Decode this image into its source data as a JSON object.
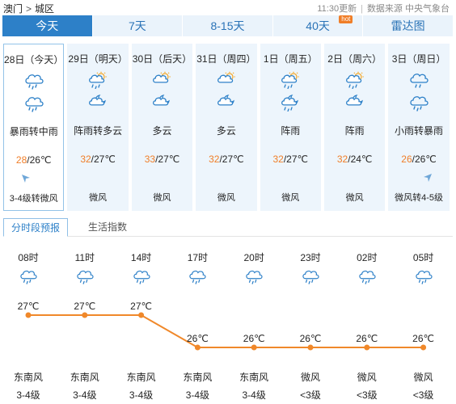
{
  "header": {
    "breadcrumb": [
      "澳门",
      "城区"
    ],
    "breadcrumb_sep": ">",
    "update_time": "11:30更新",
    "source": "数据来源 中央气象台"
  },
  "tabs": [
    {
      "label": "今天",
      "active": true
    },
    {
      "label": "7天",
      "active": false
    },
    {
      "label": "8-15天",
      "active": false
    },
    {
      "label": "40天",
      "active": false,
      "badge": "hot"
    },
    {
      "label": "雷达图",
      "active": false
    }
  ],
  "days": [
    {
      "date": "28日（今天）",
      "icon_day": "rain-heavy-icon",
      "icon_night": "rain-heavy-icon",
      "desc": "暴雨转中雨",
      "hi": "28",
      "lo": "/26℃",
      "wind": "3-4级转微风",
      "arrow": "left"
    },
    {
      "date": "29日（明天）",
      "icon_day": "thundershower-icon",
      "icon_night": "partly-cloudy-night-icon",
      "desc": "阵雨转多云",
      "hi": "32",
      "lo": "/27℃",
      "wind": "微风"
    },
    {
      "date": "30日（后天）",
      "icon_day": "partly-cloudy-icon",
      "icon_night": "partly-cloudy-night-icon",
      "desc": "多云",
      "hi": "33",
      "lo": "/27℃",
      "wind": "微风"
    },
    {
      "date": "31日（周四）",
      "icon_day": "partly-cloudy-icon",
      "icon_night": "partly-cloudy-night-icon",
      "desc": "多云",
      "hi": "32",
      "lo": "/27℃",
      "wind": "微风"
    },
    {
      "date": "1日（周五）",
      "icon_day": "thundershower-icon",
      "icon_night": "thundershower-night-icon",
      "desc": "阵雨",
      "hi": "32",
      "lo": "/27℃",
      "wind": "微风"
    },
    {
      "date": "2日（周六）",
      "icon_day": "thundershower-icon",
      "icon_night": "partly-cloudy-night-icon",
      "desc": "阵雨",
      "hi": "32",
      "lo": "/24℃",
      "wind": "微风"
    },
    {
      "date": "3日（周日）",
      "icon_day": "rain-icon",
      "icon_night": "rain-heavy-icon",
      "desc": "小雨转暴雨",
      "hi": "26",
      "lo": "/26℃",
      "wind": "微风转4-5级",
      "arrow": "right"
    }
  ],
  "subtabs": [
    {
      "label": "分时段预报",
      "active": true
    },
    {
      "label": "生活指数",
      "active": false
    }
  ],
  "hourly": [
    {
      "hour": "08时",
      "temp": 27,
      "temp_label": "27℃",
      "wind_dir": "东南风",
      "wind_level": "3-4级"
    },
    {
      "hour": "11时",
      "temp": 27,
      "temp_label": "27℃",
      "wind_dir": "东南风",
      "wind_level": "3-4级"
    },
    {
      "hour": "14时",
      "temp": 27,
      "temp_label": "27℃",
      "wind_dir": "东南风",
      "wind_level": "3-4级"
    },
    {
      "hour": "17时",
      "temp": 26,
      "temp_label": "26℃",
      "wind_dir": "东南风",
      "wind_level": "3-4级"
    },
    {
      "hour": "20时",
      "temp": 26,
      "temp_label": "26℃",
      "wind_dir": "东南风",
      "wind_level": "3-4级"
    },
    {
      "hour": "23时",
      "temp": 26,
      "temp_label": "26℃",
      "wind_dir": "微风",
      "wind_level": "<3级"
    },
    {
      "hour": "02时",
      "temp": 26,
      "temp_label": "26℃",
      "wind_dir": "微风",
      "wind_level": "<3级"
    },
    {
      "hour": "05时",
      "temp": 26,
      "temp_label": "26℃",
      "wind_dir": "微风",
      "wind_level": "<3级"
    }
  ],
  "colors": {
    "accent": "#2d80c8",
    "line": "#f0882a",
    "hi_temp": "#f07e28",
    "icon": "#2d80c8",
    "sun": "#f5a623"
  }
}
